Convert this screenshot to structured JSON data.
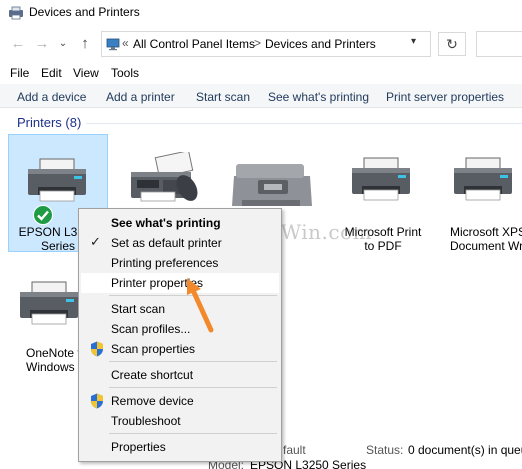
{
  "window": {
    "title": "Devices and Printers"
  },
  "address": {
    "chevrons": "«",
    "segments": [
      "All Control Panel Items",
      "Devices and Printers"
    ],
    "separator": ">"
  },
  "menubar": [
    "File",
    "Edit",
    "View",
    "Tools"
  ],
  "commands": [
    "Add a device",
    "Add a printer",
    "Start scan",
    "See what's printing",
    "Print server properties"
  ],
  "group": {
    "title": "Printers (8)"
  },
  "printers": [
    {
      "line1": "EPSON L3250",
      "line2": "Series"
    },
    {
      "line1": "",
      "line2": ""
    },
    {
      "line1": "et Pro",
      "line2": "0"
    },
    {
      "line1": "Microsoft Print",
      "line2": "to PDF"
    },
    {
      "line1": "Microsoft XPS",
      "line2": "Document Writ"
    },
    {
      "line1": "OneNote fo",
      "line2": "Windows 1"
    }
  ],
  "watermark": "RepairWin.com",
  "context_menu": {
    "items": [
      {
        "label": "See what's printing",
        "bold": true
      },
      {
        "label": "Set as default printer",
        "checked": true
      },
      {
        "label": "Printing preferences"
      },
      {
        "label": "Printer properties",
        "highlighted": true
      },
      {
        "label": "Start scan"
      },
      {
        "label": "Scan profiles..."
      },
      {
        "label": "Scan properties",
        "shield": true
      },
      {
        "label": "Create shortcut"
      },
      {
        "label": "Remove device",
        "shield": true
      },
      {
        "label": "Troubleshoot"
      },
      {
        "label": "Properties"
      }
    ]
  },
  "status": {
    "state_fragment": "fault",
    "status_label": "Status:",
    "status_value": "0 document(s) in queue",
    "model_label": "Model:",
    "model_value": "EPSON L3250 Series"
  },
  "colors": {
    "accent_arrow": "#f28a2d",
    "selection": "#cce8ff",
    "group_header": "#1e3287",
    "default_check": "#1e9b45"
  }
}
